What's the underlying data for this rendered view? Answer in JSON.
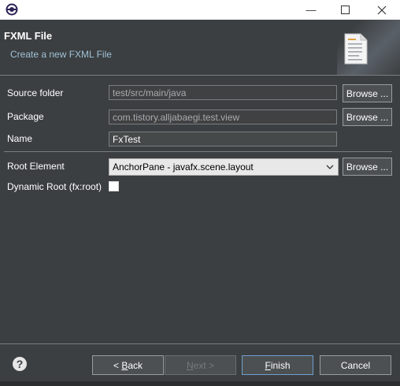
{
  "header": {
    "title": "FXML File",
    "subtitle": "Create a new FXML File"
  },
  "form": {
    "source_folder_label": "Source folder",
    "source_folder_value": "test/src/main/java",
    "package_label": "Package",
    "package_value": "com.tistory.alljabaegi.test.view",
    "name_label": "Name",
    "name_value": "FxTest",
    "root_element_label": "Root Element",
    "root_element_value": "AnchorPane - javafx.scene.layout",
    "dynamic_root_label": "Dynamic Root (fx:root)",
    "dynamic_root_checked": false,
    "browse_label": "Browse ..."
  },
  "footer": {
    "back_prefix": "< ",
    "back_mnemonic": "B",
    "back_rest": "ack",
    "next_mnemonic": "N",
    "next_rest": "ext >",
    "finish_mnemonic": "F",
    "finish_rest": "inish",
    "cancel_label": "Cancel"
  },
  "icons": {
    "app": "eclipse-icon",
    "minimize": "minimize-icon",
    "maximize": "maximize-icon",
    "close": "close-icon",
    "wizard_banner": "document-icon",
    "help": "help-icon",
    "dropdown": "chevron-down-icon"
  },
  "colors": {
    "background": "#3c3f41",
    "subtitle": "#9fc2d6",
    "default_button_border": "#6f9fcf"
  }
}
